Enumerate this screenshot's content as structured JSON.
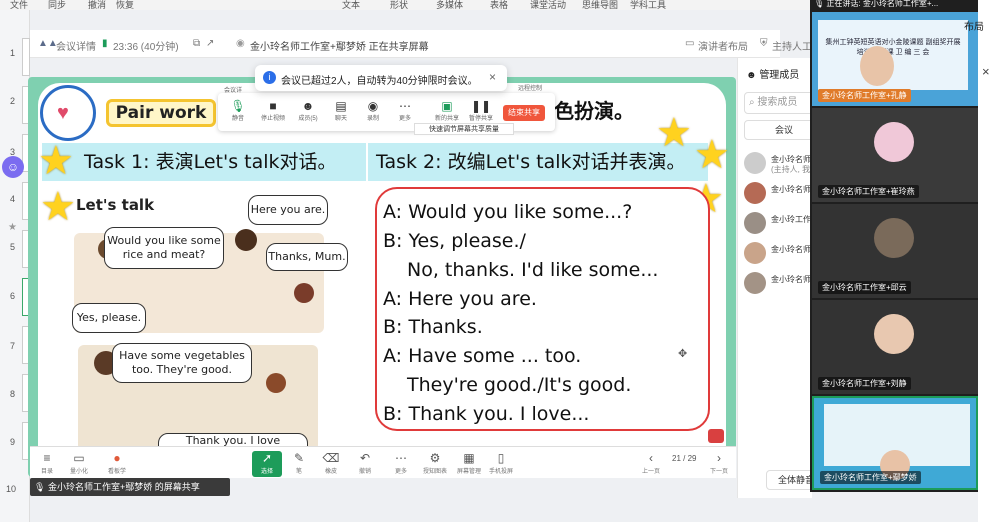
{
  "top_menu": [
    "文件",
    "同步",
    "撤消",
    "恢复",
    "文本",
    "形状",
    "多媒体",
    "表格",
    "课堂活动",
    "思维导图",
    "学科工具"
  ],
  "slide_numbers": [
    "1",
    "2",
    "3",
    "4",
    "5",
    "6",
    "7",
    "8",
    "9",
    "10"
  ],
  "meeting_bar": {
    "details_label": "会议详情",
    "timer": "23:36 (40分钟)",
    "sharer_title": "金小玲名师工作室+鄢梦娇  正在共享屏幕",
    "layout_label": "演讲者布局",
    "host_label": "主持人工"
  },
  "toast": {
    "message": "会议已超过2人，自动转为40分钟限时会议。",
    "close": "×"
  },
  "share_controls": {
    "buttons": [
      "静音",
      "停止视频",
      "成员(5)",
      "聊天",
      "录制",
      "更多",
      "新的共享",
      "暂停共享"
    ],
    "end_share": "结束共享",
    "tooltip": "快速调节屏幕共享质量",
    "top_label": "会议详",
    "remote_label": "远程控制"
  },
  "slide": {
    "pair_work": "Pair work",
    "header_tail": "色扮演。",
    "task1": "Task 1: 表演Let's talk对话。",
    "task2": "Task 2: 改编Let's talk对话并表演。",
    "lets_talk": "Let's talk",
    "bubbles": [
      "Here you are.",
      "Would you like some rice and meat?",
      "Thanks, Mum.",
      "Yes, please.",
      "Have some vegetables too. They're good.",
      "Thank you. I love vegetables."
    ],
    "dialog_lines": [
      "A: Would you like some...?",
      "B: Yes, please./",
      "No, thanks. I'd like some...",
      "A: Here you are.",
      "B: Thanks.",
      "A: Have some ... too.",
      "They're good./It's good.",
      "B: Thank you. I love..."
    ]
  },
  "bottom_toolbar": {
    "left": [
      "目录",
      "量小化",
      "看板学"
    ],
    "center": [
      "选择",
      "笔",
      "橡皮",
      "撤销",
      "更多",
      "授知图表",
      "屏幕管理",
      "手机投屏"
    ],
    "page_indicator": "21 / 29",
    "prev": "上一页",
    "next": "下一页"
  },
  "share_label": "金小玲名师工作室+鄢梦娇 的屏幕共享",
  "members_panel": {
    "title": "管理成员",
    "search_placeholder": "搜索成员",
    "meeting_btn": "会议",
    "members": [
      {
        "name": "金小玲名师",
        "sub": "(主持人, 我"
      },
      {
        "name": "金小玲名师",
        "sub": ""
      },
      {
        "name": "金小玲工作",
        "sub": ""
      },
      {
        "name": "金小玲名师",
        "sub": ""
      },
      {
        "name": "金小玲名师",
        "sub": ""
      }
    ],
    "mute_all": "全体静音"
  },
  "video_column": {
    "speaking_label": "正在讲话:",
    "speaking_name": "金小玲名师工作室+...",
    "tiles": [
      "金小玲名师工作室+孔静",
      "金小玲名师工作室+崔玲燕",
      "金小玲名师工作室+邱云",
      "金小玲名师工作室+刘静",
      "金小玲名师工作室+鄢梦娇"
    ],
    "tile1_text": "集州工钟英短英语对小金陵课题 副组奖开展培训 各研课 卫 编 三 会"
  },
  "right_strip": {
    "label": "布局",
    "close": "×"
  },
  "colors": {
    "slide_border": "#7fd0b0",
    "cyan_bar": "#c3eef4",
    "dialog_border": "#e03a3a",
    "end_share": "#f0563c",
    "star": "#ffd21f"
  }
}
